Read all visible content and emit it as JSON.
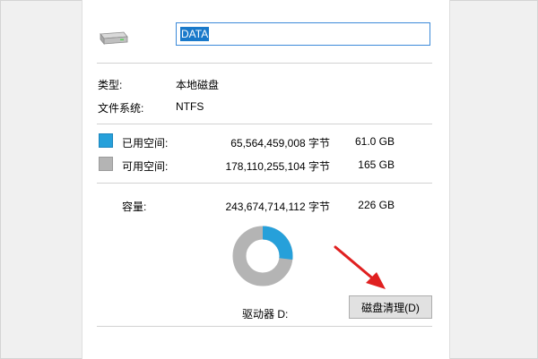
{
  "drive": {
    "icon": "drive-icon",
    "name_value": "DATA"
  },
  "info": {
    "type_label": "类型:",
    "type_value": "本地磁盘",
    "fs_label": "文件系统:",
    "fs_value": "NTFS"
  },
  "space": {
    "used": {
      "label": "已用空间:",
      "bytes": "65,564,459,008 字节",
      "size": "61.0 GB",
      "color": "#26a0da",
      "fraction": 0.269
    },
    "free": {
      "label": "可用空间:",
      "bytes": "178,110,255,104 字节",
      "size": "165 GB",
      "color": "#b4b4b4"
    },
    "capacity": {
      "label": "容量:",
      "bytes": "243,674,714,112 字节",
      "size": "226 GB"
    }
  },
  "footer": {
    "drive_label": "驱动器 D:",
    "cleanup_button": "磁盘清理(D)"
  },
  "annotation": {
    "icon": "red-arrow-icon",
    "color": "#e02020"
  }
}
